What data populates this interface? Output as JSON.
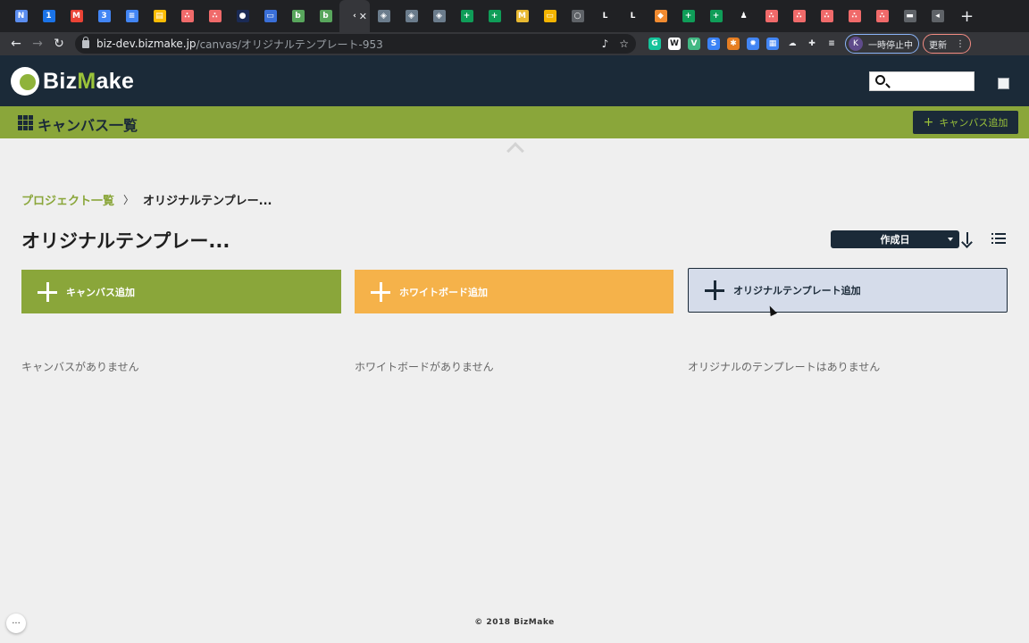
{
  "browser": {
    "tabs": [
      {
        "icon": "notion-icon",
        "color": "#5b8def",
        "glyph": "N"
      },
      {
        "icon": "1password-icon",
        "color": "#1a73e8",
        "glyph": "1"
      },
      {
        "icon": "gmail-icon",
        "color": "#ea4335",
        "glyph": "M"
      },
      {
        "icon": "calendar-icon",
        "color": "#4285f4",
        "glyph": "3"
      },
      {
        "icon": "docs-icon",
        "color": "#4285f4",
        "glyph": "≡"
      },
      {
        "icon": "folder-icon",
        "color": "#fbbc04",
        "glyph": "▤"
      },
      {
        "icon": "asana-icon",
        "color": "#f06a6a",
        "glyph": "∴"
      },
      {
        "icon": "asana-icon",
        "color": "#f06a6a",
        "glyph": "∴"
      },
      {
        "icon": "globe-icon",
        "color": "#1a2a55",
        "glyph": "●"
      },
      {
        "icon": "app-icon",
        "color": "#3a6fd8",
        "glyph": "▭"
      },
      {
        "icon": "bizmake-icon",
        "color": "#58a65c",
        "glyph": "b"
      },
      {
        "icon": "bizmake-icon",
        "color": "#58a65c",
        "glyph": "b"
      },
      {
        "icon": "loading-icon",
        "color": "#35363a",
        "glyph": "‹",
        "active": true
      },
      {
        "icon": "cube-icon",
        "color": "#6b7c8c",
        "glyph": "◈"
      },
      {
        "icon": "cube-icon",
        "color": "#6b7c8c",
        "glyph": "◈"
      },
      {
        "icon": "cube-icon",
        "color": "#6b7c8c",
        "glyph": "◈"
      },
      {
        "icon": "sheets-icon",
        "color": "#0f9d58",
        "glyph": "+"
      },
      {
        "icon": "sheets-icon",
        "color": "#0f9d58",
        "glyph": "+"
      },
      {
        "icon": "miro-icon",
        "color": "#e8b931",
        "glyph": "M"
      },
      {
        "icon": "slides-icon",
        "color": "#f4b400",
        "glyph": "▭"
      },
      {
        "icon": "globe-icon",
        "color": "#5f6368",
        "glyph": "○"
      },
      {
        "icon": "line-icon",
        "color": "#202124",
        "glyph": "L"
      },
      {
        "icon": "line-icon",
        "color": "#202124",
        "glyph": "L"
      },
      {
        "icon": "box-icon",
        "color": "#f28b30",
        "glyph": "◆"
      },
      {
        "icon": "sheets-icon",
        "color": "#0f9d58",
        "glyph": "+"
      },
      {
        "icon": "sheets-icon",
        "color": "#0f9d58",
        "glyph": "+"
      },
      {
        "icon": "chess-icon",
        "color": "#202124",
        "glyph": "♟"
      },
      {
        "icon": "asana-icon",
        "color": "#f06a6a",
        "glyph": "∴"
      },
      {
        "icon": "asana-icon",
        "color": "#f06a6a",
        "glyph": "∴"
      },
      {
        "icon": "asana-icon",
        "color": "#f06a6a",
        "glyph": "∴"
      },
      {
        "icon": "asana-icon",
        "color": "#f06a6a",
        "glyph": "∴"
      },
      {
        "icon": "asana-icon",
        "color": "#f06a6a",
        "glyph": "∴"
      },
      {
        "icon": "car-icon",
        "color": "#5f6368",
        "glyph": "▬"
      },
      {
        "icon": "audio-icon",
        "color": "#5f6368",
        "glyph": "◂"
      }
    ],
    "url_host": "biz-dev.bizmake.jp",
    "url_path": "/canvas/オリジナルテンプレート-953",
    "paused_avatar": "K",
    "paused_label": "一時停止中",
    "update_label": "更新",
    "extensions": [
      {
        "icon": "grammarly-icon",
        "color": "#15c39a",
        "glyph": "G"
      },
      {
        "icon": "w-icon",
        "color": "#ffffff",
        "glyph": "W"
      },
      {
        "icon": "vue-icon",
        "color": "#42b883",
        "glyph": "V"
      },
      {
        "icon": "s-icon",
        "color": "#3b82f6",
        "glyph": "S"
      },
      {
        "icon": "bug-icon",
        "color": "#e67e22",
        "glyph": "✱"
      },
      {
        "icon": "palette-icon",
        "color": "#4285f4",
        "glyph": "✹"
      },
      {
        "icon": "grid-icon",
        "color": "#4285f4",
        "glyph": "▦"
      },
      {
        "icon": "cloud-icon",
        "color": "#e8eaed",
        "glyph": "☁"
      },
      {
        "icon": "puzzle-icon",
        "color": "#e8eaed",
        "glyph": "✚"
      },
      {
        "icon": "reading-list-icon",
        "color": "#e8eaed",
        "glyph": "≡"
      }
    ]
  },
  "header": {
    "logo_biz": "Biz",
    "logo_m": "M",
    "logo_rest": "ake",
    "search_placeholder": ""
  },
  "subbar": {
    "title": "キャンバス一覧",
    "add_button": "キャンバス追加"
  },
  "breadcrumb": {
    "link": "プロジェクト一覧",
    "separator": "〉",
    "current": "オリジナルテンプレー..."
  },
  "page": {
    "title": "オリジナルテンプレー...",
    "sort_selected": "作成日"
  },
  "buttons": {
    "add_canvas": "キャンバス追加",
    "add_whiteboard": "ホワイトボード追加",
    "add_template": "オリジナルテンプレート追加"
  },
  "empty_states": {
    "canvas": "キャンバスがありません",
    "whiteboard": "ホワイトボードがありません",
    "template": "オリジナルのテンプレートはありません"
  },
  "footer": {
    "copyright": "© 2018 BizMake",
    "more": "···"
  },
  "colors": {
    "navy": "#1b2a38",
    "green": "#8aa63a",
    "orange": "#f5b24a",
    "template_bg": "#d5dcea"
  }
}
